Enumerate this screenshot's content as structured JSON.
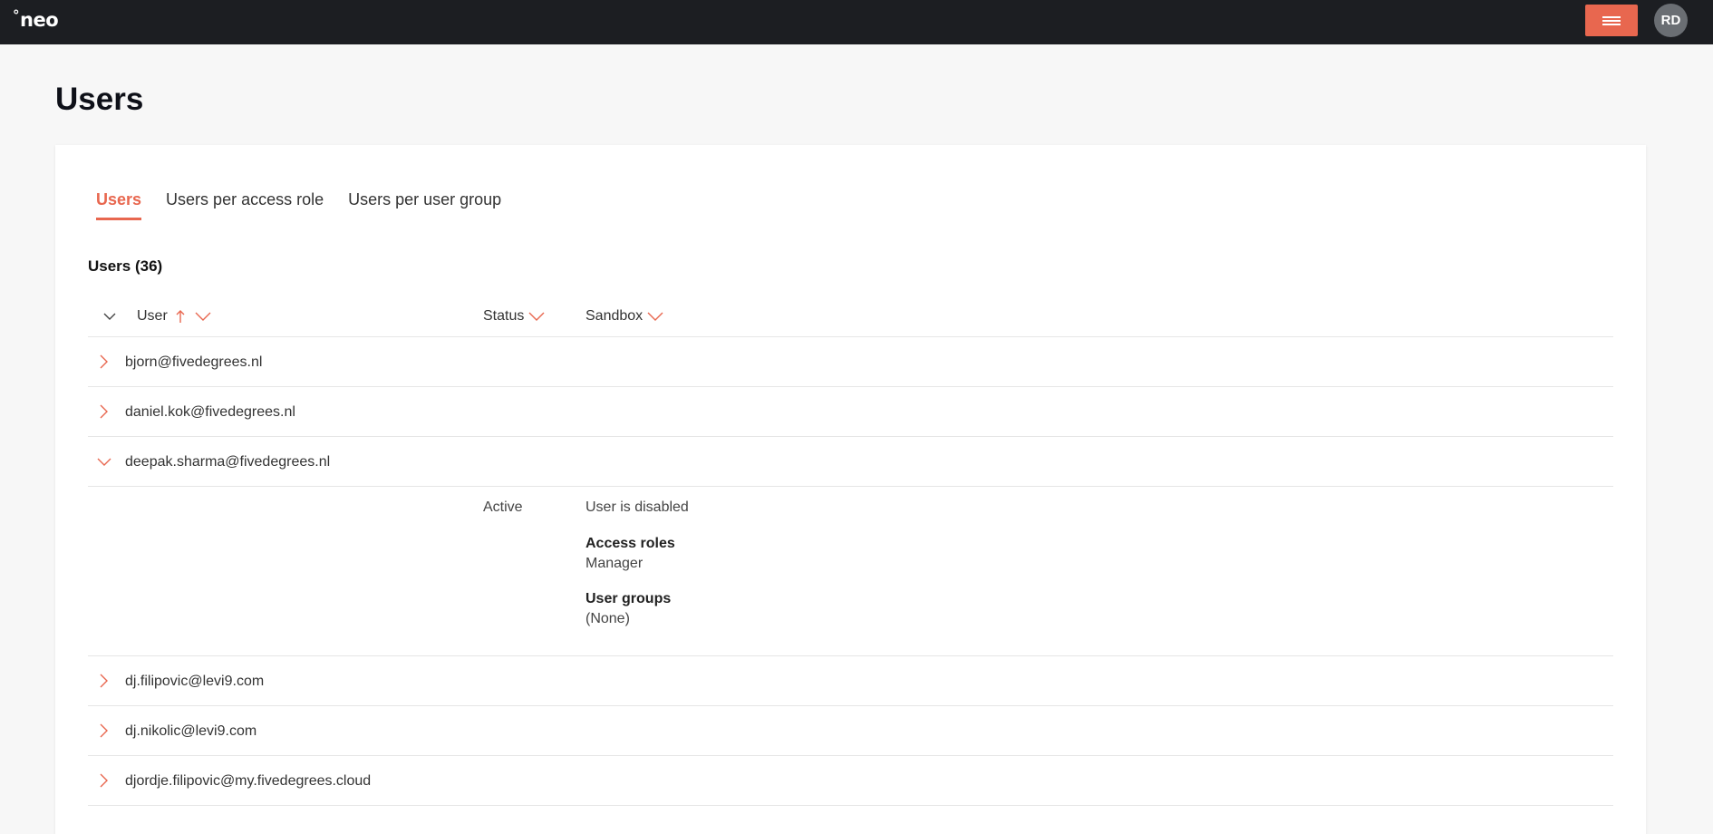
{
  "header": {
    "logo_mark": "°",
    "logo_text": "neo",
    "avatar_initials": "RD",
    "accent_color": "#e8674f"
  },
  "page": {
    "title": "Users"
  },
  "tabs": [
    {
      "label": "Users",
      "active": true
    },
    {
      "label": "Users per access role",
      "active": false
    },
    {
      "label": "Users per user group",
      "active": false
    }
  ],
  "section": {
    "title": "Users (36)"
  },
  "table": {
    "columns": {
      "user": "User",
      "status": "Status",
      "sandbox": "Sandbox"
    },
    "sort": {
      "column": "User",
      "direction": "ascending"
    },
    "rows": [
      {
        "email": "bjorn@fivedegrees.nl",
        "expanded": false
      },
      {
        "email": "daniel.kok@fivedegrees.nl",
        "expanded": false
      },
      {
        "email": "deepak.sharma@fivedegrees.nl",
        "expanded": true
      },
      {
        "email": "dj.filipovic@levi9.com",
        "expanded": false
      },
      {
        "email": "dj.nikolic@levi9.com",
        "expanded": false
      },
      {
        "email": "djordje.filipovic@my.fivedegrees.cloud",
        "expanded": false
      }
    ],
    "expanded_details": {
      "status": "Active",
      "sandbox": "User is disabled",
      "access_roles_label": "Access roles",
      "access_roles_value": "Manager",
      "user_groups_label": "User groups",
      "user_groups_value": "(None)"
    }
  }
}
